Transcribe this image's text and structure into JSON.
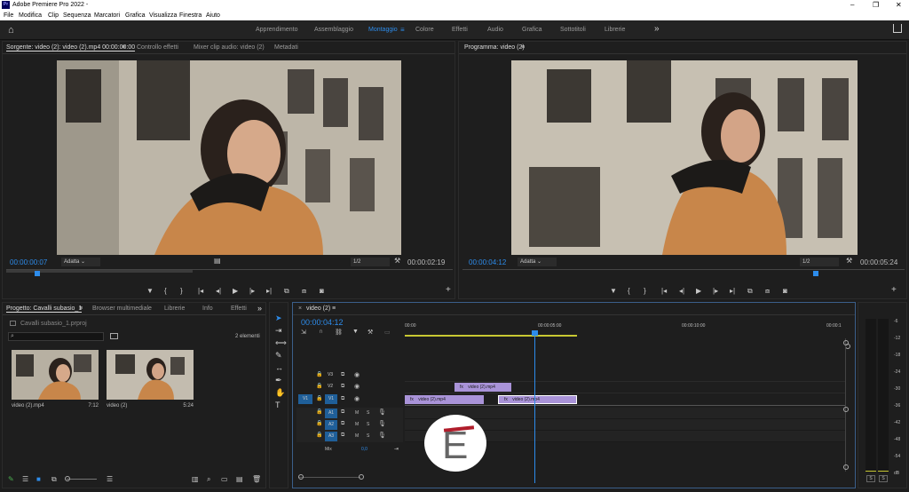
{
  "app": {
    "title": "Adobe Premiere Pro 2022 -",
    "logo": "Pr"
  },
  "window_controls": {
    "minimize": "–",
    "maximize": "❐",
    "close": "✕"
  },
  "menu": [
    "File",
    "Modifica",
    "Clip",
    "Sequenza",
    "Marcatori",
    "Grafica",
    "Visualizza",
    "Finestra",
    "Aiuto"
  ],
  "workspaces": {
    "items": [
      "Apprendimento",
      "Assemblaggio",
      "Montaggio",
      "Colore",
      "Effetti",
      "Audio",
      "Grafica",
      "Sottotitoli",
      "Librerie"
    ],
    "active": "Montaggio",
    "overflow": "»"
  },
  "source_monitor": {
    "tabs": [
      "Sorgente: video (2): video (2).mp4  00:00:00:00",
      "Controllo effetti",
      "Mixer clip audio: video (2)",
      "Metadati"
    ],
    "menu_icon": "≡",
    "timecode_current": "00:00:00:07",
    "fit": "Adatta",
    "resolution": "1/2",
    "timecode_duration": "00:00:02:19",
    "playhead_fraction": 0.07
  },
  "program_monitor": {
    "tab": "Programma: video (2)",
    "menu_icon": "≡",
    "timecode_current": "00:00:04:12",
    "fit": "Adatta",
    "resolution": "1/2",
    "timecode_duration": "00:00:05:24",
    "playhead_fraction": 0.8
  },
  "transport": {
    "marker": "▼",
    "in": "{",
    "out": "}",
    "goto_in": "|◂",
    "step_back": "◂|",
    "play": "▶",
    "step_fwd": "|▸",
    "goto_out": "▸|",
    "insert": "⧉",
    "overwrite": "⧈",
    "export_frame": "◙",
    "add": "+"
  },
  "project": {
    "tabs": [
      "Progetto: Cavalli subasio_1",
      "Browser multimediale",
      "Librerie",
      "Info",
      "Effetti"
    ],
    "overflow": "»",
    "file": "Cavalli subasio_1.prproj",
    "count": "2 elementi",
    "items": [
      {
        "name": "video (2).mp4",
        "duration": "7:12"
      },
      {
        "name": "video (2)",
        "duration": "5:24"
      }
    ]
  },
  "tools": [
    "selection-icon",
    "track-select-icon",
    "ripple-icon",
    "razor-icon",
    "slip-icon",
    "pen-icon",
    "hand-icon",
    "type-icon"
  ],
  "tool_glyphs": [
    "➤",
    "⇥",
    "⟺",
    "✎",
    "↔",
    "✒",
    "✋",
    "T"
  ],
  "timeline": {
    "close": "×",
    "sequence_name": "video (2)",
    "menu_icon": "≡",
    "timecode": "00:00:04:12",
    "ruler": [
      "00:00",
      "00:00:05:00",
      "00:00:10:00",
      "00:00:1"
    ],
    "video_tracks": [
      "V3",
      "V2",
      "V1"
    ],
    "audio_tracks": [
      "A1",
      "A2",
      "A3"
    ],
    "source_patch_v": "V1",
    "source_patch_a": "A1",
    "mix_label": "Mix",
    "mix_value": "0,0",
    "mute": "M",
    "solo": "S",
    "clips": [
      {
        "track": "V2",
        "label": "video (2).mp4",
        "fx": "fx"
      },
      {
        "track": "V1",
        "label": "video (2).mp4",
        "fx": "fx"
      },
      {
        "track": "V1",
        "label": "video (2).mp4",
        "fx": "fx",
        "selected": true
      }
    ],
    "playhead_fraction": 0.295
  },
  "audio_meter": {
    "scale": [
      "-6",
      "-12",
      "-18",
      "-24",
      "-30",
      "-36",
      "-42",
      "-48",
      "-54",
      "dB"
    ],
    "solo_buttons": [
      "S",
      "S"
    ]
  },
  "watermark": {
    "letter": "E"
  },
  "colors": {
    "accent": "#2d8ceb",
    "clip": "#a993d8",
    "background": "#1d1d1d"
  }
}
